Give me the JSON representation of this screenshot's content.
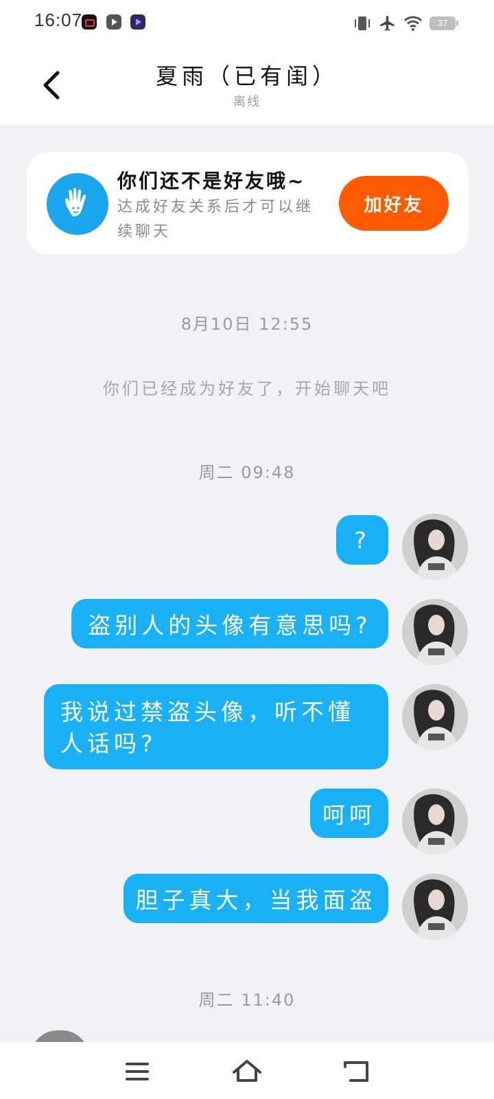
{
  "status_bar": {
    "time": "16:07",
    "battery": "37",
    "app_icons": [
      "screen-recorder-icon",
      "video-player-icon",
      "media-app-icon"
    ],
    "indicators": [
      "vibrate-icon",
      "airplane-mode-icon",
      "wifi-icon",
      "battery-icon"
    ]
  },
  "header": {
    "back_icon": "chevron-left-icon",
    "title": "夏雨（已有闺）",
    "subtitle": "离线"
  },
  "friend_notice": {
    "icon": "waving-hand-icon",
    "title": "你们还不是好友哦~",
    "description": "达成好友关系后才可以继续聊天",
    "button_label": "加好友",
    "button_color": "#ff5a00"
  },
  "chat": {
    "timestamp_1": "8月10日 12:55",
    "system_message": "你们已经成为好友了，开始聊天吧",
    "timestamp_2": "周二 09:48",
    "timestamp_3": "周二 11:40",
    "bubble_color": "#1ab0f6",
    "messages": [
      {
        "sender": "me",
        "text": "?"
      },
      {
        "sender": "me",
        "text": "盗别人的头像有意思吗?"
      },
      {
        "sender": "me",
        "text": "我说过禁盗头像，听不懂人话吗?"
      },
      {
        "sender": "me",
        "text": "呵呵"
      },
      {
        "sender": "me",
        "text": "胆子真大，当我面盗"
      }
    ]
  },
  "nav_bar": {
    "buttons": [
      "menu-icon",
      "home-icon",
      "back-icon"
    ]
  }
}
